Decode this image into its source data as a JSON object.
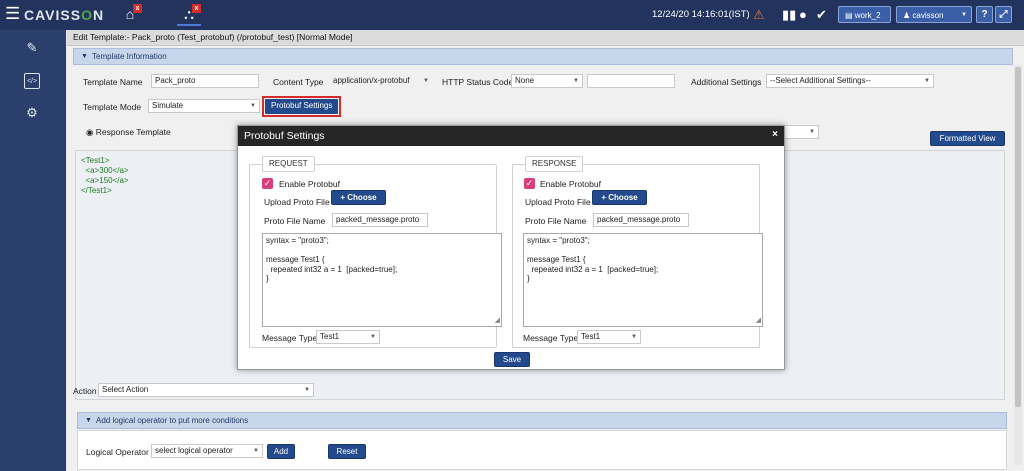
{
  "app": {
    "logo_left": "CAVISS",
    "logo_mid": "O",
    "logo_right": "N"
  },
  "topbar": {
    "datetime": "12/24/20 14:16:01(IST)",
    "workspace": "work_2",
    "user": "cavisson",
    "help": "?",
    "close_x": "x"
  },
  "page": {
    "title": "Edit Template:- Pack_proto (Test_protobuf) (/protobuf_test) [Normal Mode]"
  },
  "template_info": {
    "section_title": "Template Information",
    "template_name_label": "Template Name",
    "template_name_value": "Pack_proto",
    "content_type_label": "Content Type",
    "content_type_value": "application/x-protobuf",
    "http_status_label": "HTTP Status Code",
    "http_status_value": "None",
    "additional_settings_label": "Additional Settings",
    "additional_settings_value": "--Select Additional Settings--",
    "template_mode_label": "Template Mode",
    "template_mode_value": "Simulate",
    "protobuf_button": "Protobuf Settings",
    "response_template_label": "Response Template",
    "formatted_view_button": "Formatted View"
  },
  "editor": {
    "content": "<Test1>\n  <a>300</a>\n  <a>150</a>\n</Test1>"
  },
  "action": {
    "label": "Action",
    "value": "Select Action"
  },
  "logical": {
    "section_title": "Add logical operator to put more conditions",
    "operator_label": "Logical Operator :",
    "operator_value": "select logical operator",
    "add_button": "Add",
    "reset_button": "Reset"
  },
  "modal": {
    "title": "Protobuf Settings",
    "close": "×",
    "save_button": "Save",
    "request": {
      "legend": "REQUEST",
      "enable_label": "Enable Protobuf",
      "upload_label": "Upload Proto File",
      "choose_button": "+ Choose",
      "proto_file_label": "Proto File Name",
      "proto_file_value": "packed_message.proto",
      "proto_content": "syntax = \"proto3\";\n\nmessage Test1 {\n  repeated int32 a = 1  [packed=true];\n}",
      "message_type_label": "Message Type",
      "message_type_value": "Test1"
    },
    "response": {
      "legend": "RESPONSE",
      "enable_label": "Enable Protobuf",
      "upload_label": "Upload Proto File",
      "choose_button": "+ Choose",
      "proto_file_label": "Proto File Name",
      "proto_file_value": "packed_message.proto",
      "proto_content": "syntax = \"proto3\";\n\nmessage Test1 {\n  repeated int32 a = 1  [packed=true];\n}",
      "message_type_label": "Message Type",
      "message_type_value": "Test1"
    }
  },
  "colors": {
    "topbar": "#22335d",
    "accent": "#234a8c",
    "highlight_border": "#d62b2b",
    "checkbox": "#d93f7a"
  },
  "icons": [
    "menu-icon",
    "home-icon",
    "network-icon",
    "edit-icon",
    "code-icon",
    "settings-icon",
    "alert-icon",
    "bar-chart-icon",
    "record-icon",
    "check-circle-icon",
    "user-icon",
    "expand-icon"
  ]
}
